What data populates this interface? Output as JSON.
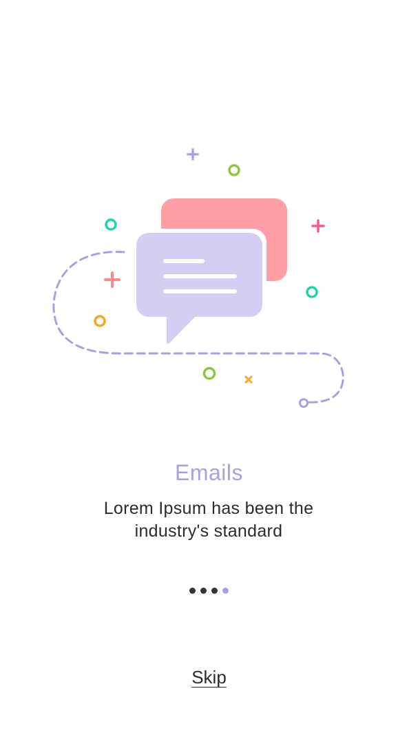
{
  "onboarding": {
    "title": "Emails",
    "description": "Lorem Ipsum has been the industry's standard",
    "skip_label": "Skip",
    "page_count": 4,
    "current_page": 4
  },
  "illustration": {
    "icon": "chat-bubbles-icon",
    "colors": {
      "front_bubble": "#d4cef2",
      "back_bubble": "#ff9ea4",
      "dashed_path": "#ab9ee6",
      "teal": "#1fd6a6",
      "green": "#8cc63f",
      "pink": "#f25b8c",
      "salmon": "#ff8a8a",
      "orange": "#f5a623",
      "purple": "#ab9ee6"
    }
  },
  "colors": {
    "title": "#ab9ee6",
    "text": "#2b2b2b",
    "dot_inactive": "#333333",
    "dot_active": "#ab9ee6"
  }
}
